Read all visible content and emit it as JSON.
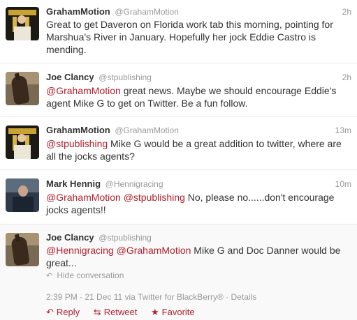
{
  "tweets": [
    {
      "fullname": "GrahamMotion",
      "screenname": "@GrahamMotion",
      "time": "2h",
      "text_lines": [
        "Great to get Daveron on Florida work tab this morning, pointing for",
        "Marshua's River in January. Hopefully her jock Eddie Castro is",
        "mending."
      ]
    },
    {
      "fullname": "Joe Clancy",
      "screenname": "@stpublishing",
      "time": "2h",
      "mention": "@GrahamMotion",
      "text_line1_rest": " great news. Maybe we should encourage Eddie's",
      "text_line2": "agent Mike G to get on Twitter. Be a fun follow."
    },
    {
      "fullname": "GrahamMotion",
      "screenname": "@GrahamMotion",
      "time": "13m",
      "mention": "@stpublishing",
      "text_line1_rest": " Mike G would be a great addition to twitter, where are",
      "text_line2": "all the jocks agents?"
    },
    {
      "fullname": "Mark Hennig",
      "screenname": "@Hennigracing",
      "time": "10m",
      "mention1": "@GrahamMotion",
      "mention2": "@stpublishing",
      "text_line1_rest": " No, please no......don't encourage",
      "text_line2": "jocks agents!!"
    },
    {
      "fullname": "Joe Clancy",
      "screenname": "@stpublishing",
      "mention1": "@Hennigracing",
      "mention2": "@GrahamMotion",
      "text_line1_rest": " Mike G and Doc Danner would be",
      "text_line2": "great...",
      "hide_conversation": "Hide conversation",
      "timestamp": "2:39 PM - 21 Dec 11 via Twitter for BlackBerry®",
      "details": "Details",
      "actions": {
        "reply": "Reply",
        "retweet": "Retweet",
        "favorite": "Favorite"
      }
    }
  ],
  "colors": {
    "mention": "#b1202e",
    "muted": "#999999"
  }
}
